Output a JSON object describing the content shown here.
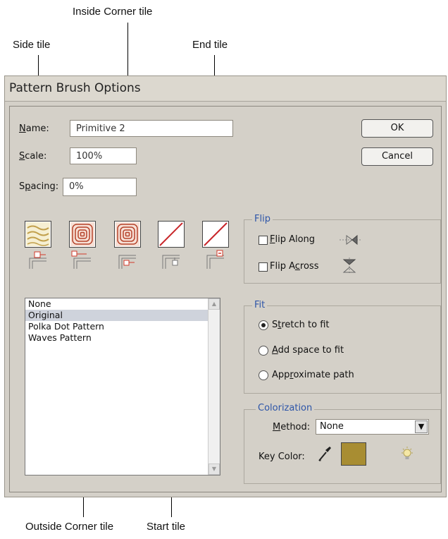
{
  "callouts": {
    "side_tile": "Side tile",
    "inside_corner_tile": "Inside Corner tile",
    "end_tile": "End tile",
    "outside_corner_tile": "Outside Corner tile",
    "start_tile": "Start tile"
  },
  "dialog": {
    "title": "Pattern Brush Options",
    "name_label": "Name:",
    "name_value": "Primitive 2",
    "scale_label": "Scale:",
    "scale_value": "100%",
    "spacing_label": "Spacing:",
    "spacing_value": "0%",
    "ok_label": "OK",
    "cancel_label": "Cancel"
  },
  "patterns": {
    "items": [
      "None",
      "Original",
      "Polka Dot Pattern",
      "Waves Pattern"
    ],
    "selected": "Original"
  },
  "flip": {
    "title": "Flip",
    "along_label": "Flip Along",
    "along_checked": false,
    "across_label": "Flip Across",
    "across_checked": false
  },
  "fit": {
    "title": "Fit",
    "options": [
      "Stretch to fit",
      "Add space to fit",
      "Approximate path"
    ],
    "selected": "Stretch to fit"
  },
  "colorization": {
    "title": "Colorization",
    "method_label": "Method:",
    "method_value": "None",
    "key_color_label": "Key Color:",
    "key_color": "#a88d32"
  },
  "icons": [
    "eyedropper-icon",
    "lightbulb-icon",
    "flip-along-icon",
    "flip-across-icon"
  ]
}
